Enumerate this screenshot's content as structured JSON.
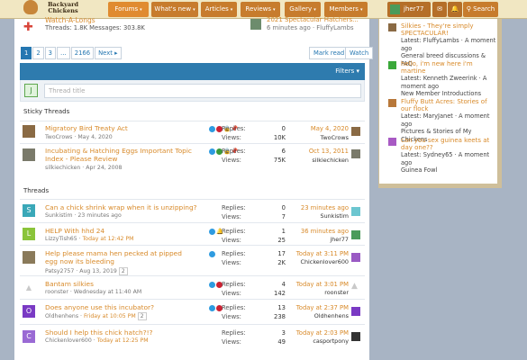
{
  "nav": {
    "logo_line1": "Backyard",
    "logo_line2": "Chickens",
    "tabs": [
      {
        "label": "Forums",
        "caret": "▾"
      },
      {
        "label": "What's new",
        "caret": "▾"
      },
      {
        "label": "Articles",
        "caret": "▾"
      },
      {
        "label": "Reviews",
        "caret": "▾"
      },
      {
        "label": "Gallery",
        "caret": "▾"
      },
      {
        "label": "Members",
        "caret": "▾"
      }
    ],
    "username": "jher77",
    "search_label": "Search",
    "mail_icon": "✉",
    "bell_icon": "🔔"
  },
  "prev_forum": {
    "title": "Watch-A-Longs",
    "stats": "Threads: 1.8K Messages: 303.8K",
    "latest_title": "2021 Spectacular Hatchers...",
    "latest_meta": "6 minutes ago · FluffyLambs"
  },
  "pager": {
    "pages": [
      "1",
      "2",
      "3",
      "…",
      "2166"
    ],
    "next": "Next ▸",
    "mark_read": "Mark read",
    "watch": "Watch"
  },
  "toolbar": {
    "filters": "Filters ▾"
  },
  "new_thread": {
    "avatar_letter": "J",
    "placeholder": "Thread title"
  },
  "sections": {
    "sticky": "Sticky Threads",
    "threads": "Threads"
  },
  "labels": {
    "replies": "Replies:",
    "views": "Views:"
  },
  "sticky_threads": [
    {
      "title": "Migratory Bird Treaty Act",
      "author": "TwoCrows",
      "date": "May 4, 2020",
      "replies": "0",
      "views": "10K",
      "last_time": "May 4, 2020",
      "last_user": "TwoCrows"
    },
    {
      "title": "Incubating & Hatching Eggs Important Topic Index - Please Review",
      "author": "silkiechicken",
      "date": "Apr 24, 2008",
      "replies": "6",
      "views": "75K",
      "last_time": "Oct 13, 2011",
      "last_user": "silkiechicken"
    }
  ],
  "threads": [
    {
      "title": "Can a chick shrink wrap when it is unzipping?",
      "author": "Sunkistim",
      "date": "23 minutes ago",
      "date_hl": false,
      "pages": "",
      "letter": "S",
      "replies": "0",
      "views": "7",
      "last_time": "23 minutes ago",
      "last_user": "Sunkistim"
    },
    {
      "title": "HELP With hhd 24",
      "author": "LizzyTish65",
      "date": "Today at 12:42 PM",
      "date_hl": true,
      "pages": "",
      "letter": "L",
      "replies": "1",
      "views": "25",
      "last_time": "36 minutes ago",
      "last_user": "jher77"
    },
    {
      "title": "Help please mama hen pecked at pipped egg now its bleeding",
      "author": "Patsy2757",
      "date": "Aug 13, 2019",
      "date_hl": false,
      "pages": "2",
      "letter": "",
      "replies": "17",
      "views": "2K",
      "last_time": "Today at 3:11 PM",
      "last_user": "Chickenlover600"
    },
    {
      "title": "Bantam silkies",
      "author": "roonster",
      "date": "Wednesday at 11:40 AM",
      "date_hl": false,
      "pages": "",
      "letter": "",
      "replies": "4",
      "views": "142",
      "last_time": "Today at 3:01 PM",
      "last_user": "roonster"
    },
    {
      "title": "Does anyone use this incubator?",
      "author": "Oldhenhens",
      "date": "Friday at 10:05 PM",
      "date_hl": true,
      "pages": "2",
      "letter": "O",
      "replies": "13",
      "views": "238",
      "last_time": "Today at 2:37 PM",
      "last_user": "Oldhenhens"
    },
    {
      "title": "Should I help this chick hatch?!?",
      "author": "Chickenlover600",
      "date": "Today at 12:25 PM",
      "date_hl": true,
      "pages": "",
      "letter": "C",
      "replies": "3",
      "views": "49",
      "last_time": "Today at 2:03 PM",
      "last_user": "casportpony"
    }
  ],
  "sidebar": [
    {
      "title": "Silkies - They're simply SPECTACULAR!",
      "latest": "Latest: FluffyLambs · A moment ago",
      "forum": "General breed discussions & FAQ"
    },
    {
      "title": "hello, i'm new here i'm martine",
      "latest": "Latest: Kenneth Zweerink · A moment ago",
      "forum": "New Member Introductions"
    },
    {
      "title": "Fluffy Butt Acres: Stories of our flock",
      "latest": "Latest: MaryJanet · A moment ago",
      "forum": "Pictures & Stories of My Chickens"
    },
    {
      "title": "can you sex guinea keets at day one??",
      "latest": "Latest: Sydney65 · A moment ago",
      "forum": "Guinea Fowl"
    }
  ]
}
